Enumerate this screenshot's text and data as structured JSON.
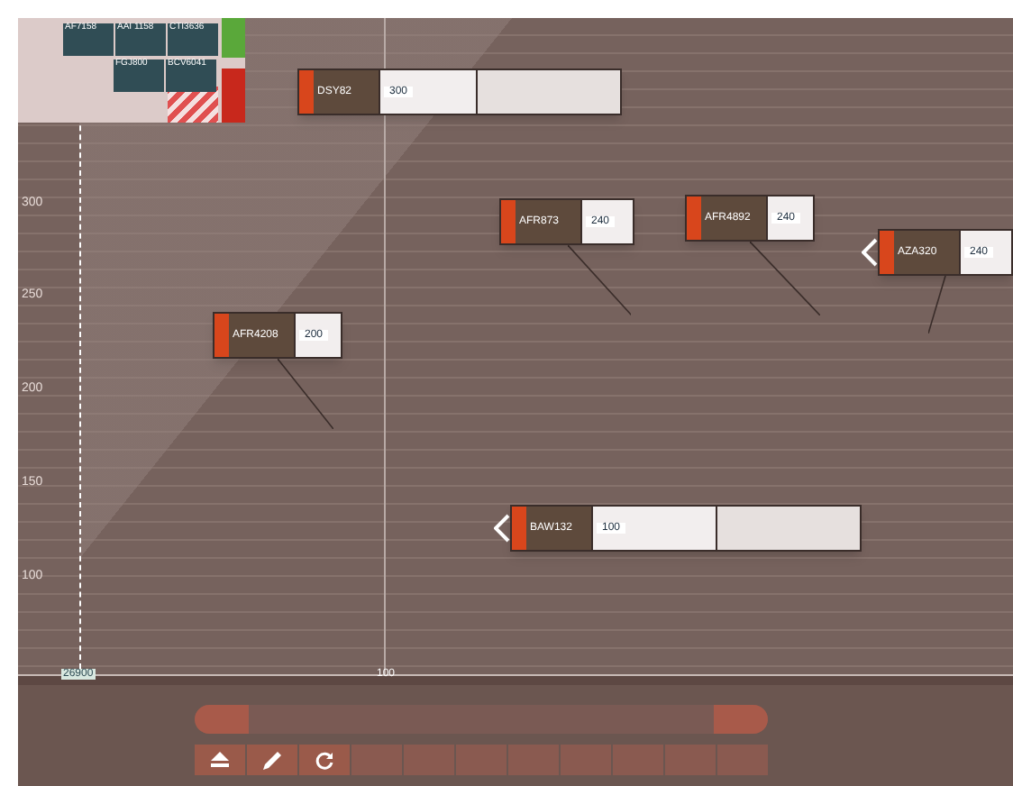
{
  "strips_upper": [
    {
      "callsign": "AF7158"
    },
    {
      "callsign": "AAI 1158"
    },
    {
      "callsign": "CTI3636"
    }
  ],
  "strips_lower": [
    {
      "callsign": "FGJ800"
    },
    {
      "callsign": "BCV6041"
    }
  ],
  "y_axis": [
    "300",
    "250",
    "200",
    "150",
    "100"
  ],
  "tags": [
    {
      "callsign": "DSY82",
      "cleared": "300",
      "kind": "wide",
      "chevron": false
    },
    {
      "callsign": "AFR873",
      "cleared": "240",
      "kind": "compact",
      "chevron": false
    },
    {
      "callsign": "AFR4892",
      "cleared": "240",
      "kind": "compact",
      "chevron": false
    },
    {
      "callsign": "AZA320",
      "cleared": "240",
      "kind": "compact",
      "chevron": true
    },
    {
      "callsign": "AFR4208",
      "cleared": "200",
      "kind": "compact",
      "chevron": false
    },
    {
      "callsign": "BAW132",
      "cleared": "100",
      "kind": "wide",
      "chevron": true
    }
  ],
  "ruler": [
    "26900",
    "100"
  ],
  "toolbar": [
    {
      "kind": "eject"
    },
    {
      "kind": "pen"
    },
    {
      "kind": "refresh"
    },
    {
      "kind": "blank"
    },
    {
      "kind": "blank"
    },
    {
      "kind": "blank"
    },
    {
      "kind": "blank"
    },
    {
      "kind": "blank"
    },
    {
      "kind": "blank"
    },
    {
      "kind": "blank"
    },
    {
      "kind": "blank"
    }
  ]
}
